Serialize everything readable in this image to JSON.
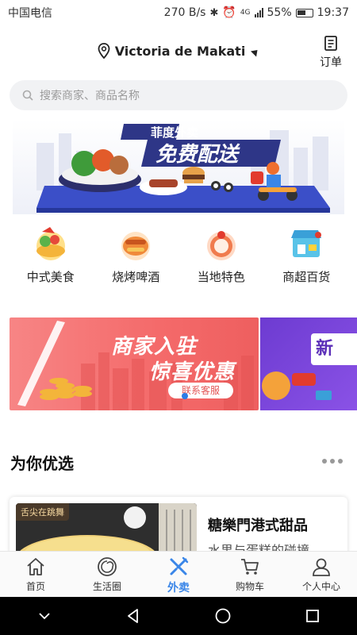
{
  "status_bar": {
    "carrier": "中国电信",
    "speed": "270 B/s",
    "network": "4G",
    "battery": "55%",
    "time": "19:37"
  },
  "header": {
    "location": "Victoria de Makati",
    "orders_label": "订单"
  },
  "search": {
    "placeholder": "搜索商家、商品名称"
  },
  "banner": {
    "brand": "菲度外卖",
    "headline": "免费配送"
  },
  "categories": [
    {
      "label": "中式美食",
      "icon": "chinese-food-icon"
    },
    {
      "label": "烧烤啤酒",
      "icon": "bbq-beer-icon"
    },
    {
      "label": "当地特色",
      "icon": "local-specialty-icon"
    },
    {
      "label": "商超百货",
      "icon": "supermarket-icon"
    }
  ],
  "promo": {
    "title": "商家入驻",
    "subtitle": "惊喜优惠",
    "button": "联系客服",
    "next_title": "新"
  },
  "section": {
    "title": "为你优选"
  },
  "featured": {
    "tag": "舌尖在跳舞",
    "title": "糖樂門港式甜品",
    "subtitle": "水果与蛋糕的碰撞"
  },
  "tabs": [
    {
      "label": "首页",
      "icon": "home-icon",
      "active": false
    },
    {
      "label": "生活圈",
      "icon": "life-circle-icon",
      "active": false
    },
    {
      "label": "外卖",
      "icon": "takeout-icon",
      "active": true
    },
    {
      "label": "购物车",
      "icon": "cart-icon",
      "active": false
    },
    {
      "label": "个人中心",
      "icon": "profile-icon",
      "active": false
    }
  ],
  "colors": {
    "accent": "#3a86e8",
    "promo_red": "#f46a6a",
    "promo_purple": "#7a45dc"
  }
}
